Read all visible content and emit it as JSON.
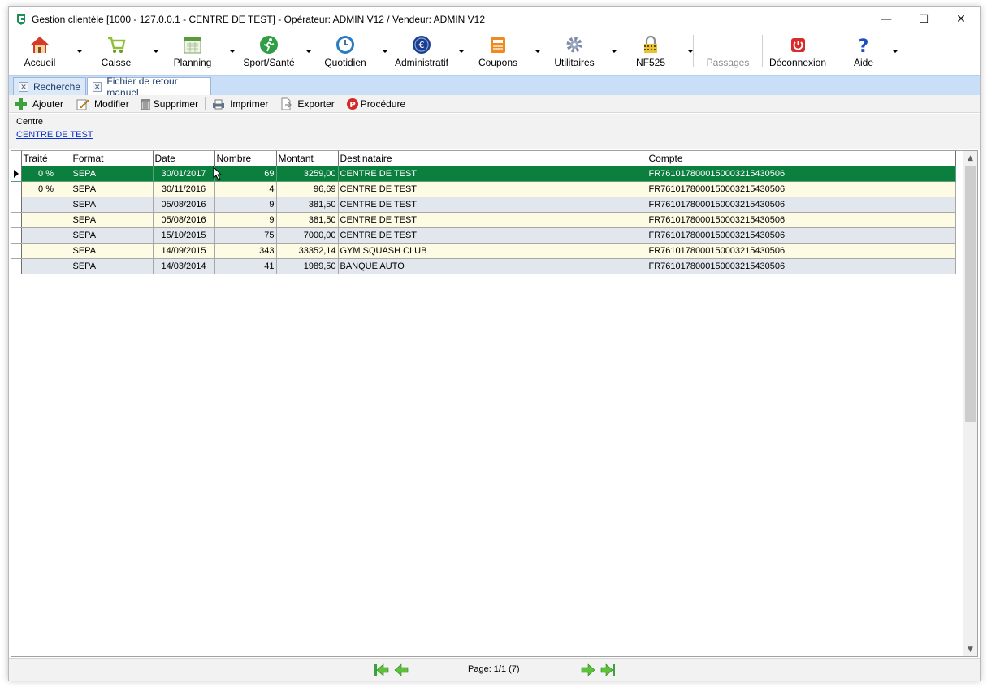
{
  "window": {
    "title": "Gestion clientèle [1000 - 127.0.0.1 - CENTRE DE TEST] - Opérateur: ADMIN V12 / Vendeur: ADMIN V12",
    "controls": [
      "—",
      "☐",
      "✕"
    ]
  },
  "toolbar": [
    {
      "label": "Accueil",
      "icon": "home-icon"
    },
    {
      "label": "Caisse",
      "icon": "cart-icon"
    },
    {
      "label": "Planning",
      "icon": "calendar-icon"
    },
    {
      "label": "Sport/Santé",
      "icon": "runner-icon"
    },
    {
      "label": "Quotidien",
      "icon": "clock-icon"
    },
    {
      "label": "Administratif",
      "icon": "euro-icon"
    },
    {
      "label": "Coupons",
      "icon": "coupon-icon"
    },
    {
      "label": "Utilitaires",
      "icon": "gear-icon"
    },
    {
      "label": "NF525",
      "icon": "lock-icon"
    },
    {
      "label": "Passages",
      "icon": ""
    },
    {
      "label": "Déconnexion",
      "icon": "power-icon"
    },
    {
      "label": "Aide",
      "icon": "help-icon"
    }
  ],
  "tabs": [
    {
      "label": "Recherche"
    },
    {
      "label": "Fichier de retour manuel"
    }
  ],
  "actions": {
    "add": "Ajouter",
    "edit": "Modifier",
    "delete": "Supprimer",
    "print": "Imprimer",
    "export": "Exporter",
    "procedure": "Procédure"
  },
  "filter": {
    "label": "Centre",
    "value": "CENTRE DE TEST"
  },
  "grid": {
    "columns": [
      "Traité",
      "Format",
      "Date",
      "Nombre",
      "Montant",
      "Destinataire",
      "Compte"
    ],
    "rows": [
      {
        "traite": "0 %",
        "format": "SEPA",
        "date": "30/01/2017",
        "nombre": "69",
        "montant": "3259,00",
        "destinataire": "CENTRE DE TEST",
        "compte": "FR7610178000150003215430506"
      },
      {
        "traite": "0 %",
        "format": "SEPA",
        "date": "30/11/2016",
        "nombre": "4",
        "montant": "96,69",
        "destinataire": "CENTRE DE TEST",
        "compte": "FR7610178000150003215430506"
      },
      {
        "traite": "",
        "format": "SEPA",
        "date": "05/08/2016",
        "nombre": "9",
        "montant": "381,50",
        "destinataire": "CENTRE DE TEST",
        "compte": "FR7610178000150003215430506"
      },
      {
        "traite": "",
        "format": "SEPA",
        "date": "05/08/2016",
        "nombre": "9",
        "montant": "381,50",
        "destinataire": "CENTRE DE TEST",
        "compte": "FR7610178000150003215430506"
      },
      {
        "traite": "",
        "format": "SEPA",
        "date": "15/10/2015",
        "nombre": "75",
        "montant": "7000,00",
        "destinataire": "CENTRE DE TEST",
        "compte": "FR7610178000150003215430506"
      },
      {
        "traite": "",
        "format": "SEPA",
        "date": "14/09/2015",
        "nombre": "343",
        "montant": "33352,14",
        "destinataire": "GYM SQUASH CLUB",
        "compte": "FR7610178000150003215430506"
      },
      {
        "traite": "",
        "format": "SEPA",
        "date": "14/03/2014",
        "nombre": "41",
        "montant": "1989,50",
        "destinataire": "BANQUE AUTO",
        "compte": "FR7610178000150003215430506"
      }
    ]
  },
  "pager": {
    "text": "Page: 1/1 (7)"
  },
  "colors": {
    "selected_row": "#0a7f3e",
    "odd_row": "#e1e7ec",
    "even_row": "#fdfbe3",
    "tab_strip": "#c9def7"
  }
}
